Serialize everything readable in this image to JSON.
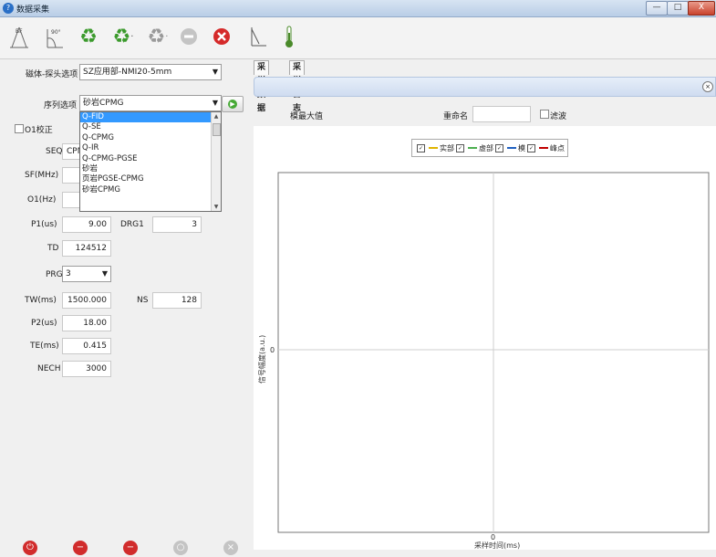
{
  "window": {
    "title": "数据采集",
    "controls": {
      "min": "—",
      "max": "□",
      "close": "X"
    }
  },
  "toolbar": {
    "buttons": [
      {
        "name": "pulse-90-icon",
        "label": "90°"
      },
      {
        "name": "refresh-icon"
      },
      {
        "name": "refresh-dropdown-icon"
      },
      {
        "name": "refresh-disabled-icon"
      },
      {
        "name": "stop-disabled-icon"
      },
      {
        "name": "cancel-icon"
      },
      {
        "name": "ruler-icon"
      },
      {
        "name": "thermometer-icon"
      }
    ]
  },
  "left": {
    "probe_label": "磁体-探头选项",
    "probe_value": "SZ应用部-NMI20-5mm",
    "seq_option_label": "序列选项",
    "seq_option_value": "砂岩CPMG",
    "dropdown_options": [
      "Q-FID",
      "Q-SE",
      "Q-CPMG",
      "Q-IR",
      "Q-CPMG-PGSE",
      "砂岩",
      "页岩PGSE-CPMG",
      "砂岩CPMG"
    ],
    "dropdown_selected_index": 0,
    "o1_checkbox_label": "O1校正",
    "seq_label": "SEQ",
    "seq_value": "CPMG",
    "sf_label": "SF(MHz)",
    "o1_label": "O1(Hz)",
    "p1_label": "P1(us)",
    "p1_value": "9.00",
    "drg1_label": "DRG1",
    "drg1_value": "3",
    "td_label": "TD",
    "td_value": "124512",
    "prg_label": "PRG",
    "prg_value": "3",
    "tw_label": "TW(ms)",
    "tw_value": "1500.000",
    "ns_label": "NS",
    "ns_value": "128",
    "p2_label": "P2(us)",
    "p2_value": "18.00",
    "te_label": "TE(ms)",
    "te_value": "0.415",
    "nech_label": "NECH",
    "nech_value": "3000"
  },
  "right": {
    "tabs": [
      "采样数据",
      "采样日志"
    ],
    "max_label": "模最大值",
    "rename_label": "重命名",
    "filter_label": "滤波",
    "legend": [
      {
        "label": "实部",
        "color": "#e0b400"
      },
      {
        "label": "虚部",
        "color": "#4caf50"
      },
      {
        "label": "模",
        "color": "#2060c0"
      },
      {
        "label": "峰点",
        "color": "#c00000"
      }
    ],
    "y_axis_label": "信号幅度(a.u.)",
    "x_axis_label": "采样时间(ms)",
    "y_zero": "0",
    "x_zero": "0"
  },
  "bottom": {
    "icons": [
      {
        "name": "power-red-icon",
        "color": "#d12c2c"
      },
      {
        "name": "minus-red-icon-1",
        "color": "#d12c2c"
      },
      {
        "name": "minus-red-icon-2",
        "color": "#d12c2c"
      },
      {
        "name": "gray-round-icon",
        "color": "#a8a8a8"
      },
      {
        "name": "gray-x-icon",
        "color": "#a8a8a8"
      }
    ]
  }
}
